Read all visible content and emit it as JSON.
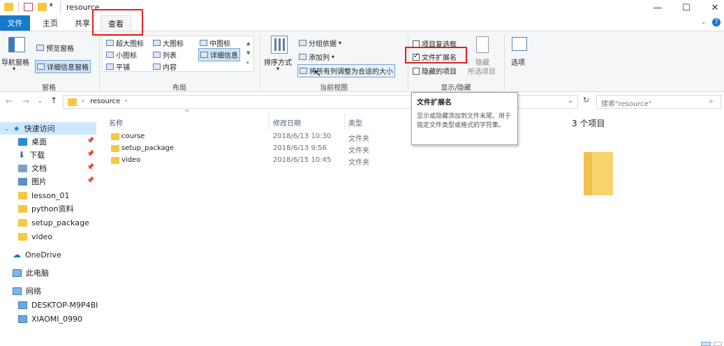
{
  "window": {
    "title": "resource",
    "controls": {
      "minimize": "—",
      "maximize": "☐",
      "close": "✕"
    }
  },
  "tabs": [
    {
      "label": "文件"
    },
    {
      "label": "主页"
    },
    {
      "label": "共享"
    },
    {
      "label": "查看"
    }
  ],
  "ribbon": {
    "panes": {
      "nav_pane": "导航窗格",
      "preview_pane": "预览窗格",
      "details_pane": "详细信息窗格",
      "group": "窗格"
    },
    "layout": {
      "extra_large": "超大图标",
      "large": "大图标",
      "medium": "中图标",
      "small": "小图标",
      "list": "列表",
      "details": "详细信息",
      "tiles": "平铺",
      "content": "内容",
      "group": "布局"
    },
    "current_view": {
      "sort_by": "排序方式",
      "group_by": "分组依据",
      "add_columns": "添加列",
      "fit_columns": "将所有列调整为合适的大小",
      "group": "当前视图"
    },
    "show_hide": {
      "item_checkboxes": "项目复选框",
      "file_extensions": "文件扩展名",
      "hidden_items": "隐藏的项目",
      "hide_selected": "隐藏",
      "hide_selected_sub": "所选项目",
      "options": "选项",
      "group": "显示/隐藏",
      "item_checkboxes_checked": false,
      "file_extensions_checked": true,
      "hidden_items_checked": false
    }
  },
  "address": {
    "path": "resource",
    "search_placeholder": "搜索\"resource\""
  },
  "nav": {
    "quick_access": "快速访问",
    "items": [
      {
        "label": "桌面",
        "pinned": true
      },
      {
        "label": "下载",
        "pinned": true
      },
      {
        "label": "文档",
        "pinned": true
      },
      {
        "label": "图片",
        "pinned": true
      },
      {
        "label": "lesson_01"
      },
      {
        "label": "python资料"
      },
      {
        "label": "setup_package"
      },
      {
        "label": "video"
      }
    ],
    "onedrive": "OneDrive",
    "this_pc": "此电脑",
    "network": "网络",
    "network_items": [
      {
        "label": "DESKTOP-M9P4BI"
      },
      {
        "label": "XIAOMI_0990"
      }
    ]
  },
  "files": {
    "columns": [
      "名称",
      "修改日期",
      "类型"
    ],
    "rows": [
      {
        "name": "course",
        "date": "2018/6/13 10:30",
        "type": "文件夹"
      },
      {
        "name": "setup_package",
        "date": "2018/6/13 9:56",
        "type": "文件夹"
      },
      {
        "name": "video",
        "date": "2018/6/15 10:45",
        "type": "文件夹"
      }
    ],
    "count": "3 个项目"
  },
  "tooltip": {
    "title": "文件扩展名",
    "body": "显示或隐藏添加到文件末尾、用于指定文件类型或格式的字符集。"
  },
  "colors": {
    "accent": "#1979ca",
    "folder": "#f5c842",
    "highlight_box": "#e02020"
  }
}
